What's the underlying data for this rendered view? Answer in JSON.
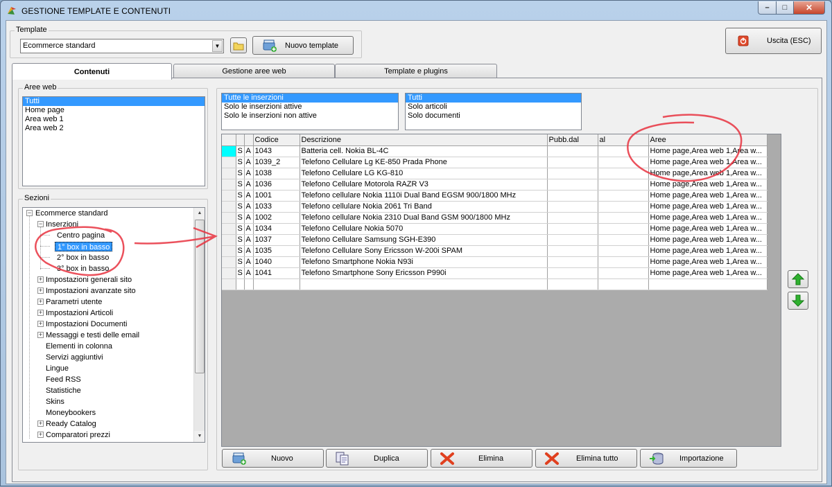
{
  "window": {
    "title": "GESTIONE TEMPLATE E CONTENUTI",
    "minimize": "–",
    "maximize": "□",
    "close": "✕"
  },
  "template": {
    "group_label": "Template",
    "selected": "Ecommerce standard",
    "new_button": "Nuovo template",
    "exit_button": "Uscita (ESC)"
  },
  "tabs": [
    {
      "label": "Contenuti",
      "active": true
    },
    {
      "label": "Gestione aree web",
      "active": false
    },
    {
      "label": "Template e plugins",
      "active": false
    }
  ],
  "aree_web": {
    "label": "Aree web",
    "items": [
      "Tutti",
      "Home page",
      "Area web 1",
      "Area web 2"
    ],
    "selected": 0
  },
  "sezioni": {
    "label": "Sezioni",
    "root": "Ecommerce standard",
    "inserzioni": "Inserzioni",
    "inserzioni_children": [
      "Centro pagina",
      "1° box in basso",
      "2° box in basso",
      "3° box in basso"
    ],
    "items": [
      "Impostazioni generali sito",
      "Impostazioni avanzate sito",
      "Parametri utente",
      "Impostazioni Articoli",
      "Impostazioni Documenti",
      "Messaggi e testi delle email",
      "Elementi in colonna",
      "Servizi aggiuntivi",
      "Lingue",
      "Feed RSS",
      "Statistiche",
      "Skins",
      "Moneybookers",
      "Ready Catalog",
      "Comparatori prezzi"
    ]
  },
  "filter_status": {
    "items": [
      "Tutte le inserzioni",
      "Solo le inserzioni attive",
      "Solo le inserzioni non attive"
    ],
    "selected": 0
  },
  "filter_type": {
    "items": [
      "Tutti",
      "Solo articoli",
      "Solo documenti"
    ],
    "selected": 0
  },
  "grid": {
    "columns": [
      "",
      "",
      "",
      "Codice",
      "Descrizione",
      "Pubb.dal",
      "al",
      "Aree"
    ],
    "rows": [
      {
        "s": "S",
        "a": "A",
        "codice": "1043",
        "descrizione": "Batteria cell. Nokia BL-4C",
        "dal": "",
        "al": "",
        "aree": "Home page,Area web 1,Area w..."
      },
      {
        "s": "S",
        "a": "A",
        "codice": "1039_2",
        "descrizione": "Telefono Cellulare Lg KE-850 Prada Phone",
        "dal": "",
        "al": "",
        "aree": "Home page,Area web 1,Area w..."
      },
      {
        "s": "S",
        "a": "A",
        "codice": "1038",
        "descrizione": "Telefono Cellulare LG KG-810",
        "dal": "",
        "al": "",
        "aree": "Home page,Area web 1,Area w..."
      },
      {
        "s": "S",
        "a": "A",
        "codice": "1036",
        "descrizione": "Telefono Cellulare Motorola RAZR V3",
        "dal": "",
        "al": "",
        "aree": "Home page,Area web 1,Area w..."
      },
      {
        "s": "S",
        "a": "A",
        "codice": "1001",
        "descrizione": "Telefono cellulare Nokia 1110i Dual Band EGSM 900/1800 MHz",
        "dal": "",
        "al": "",
        "aree": "Home page,Area web 1,Area w..."
      },
      {
        "s": "S",
        "a": "A",
        "codice": "1033",
        "descrizione": "Telefono cellulare Nokia 2061 Tri Band",
        "dal": "",
        "al": "",
        "aree": "Home page,Area web 1,Area w..."
      },
      {
        "s": "S",
        "a": "A",
        "codice": "1002",
        "descrizione": "Telefono cellulare Nokia 2310 Dual Band GSM 900/1800 MHz",
        "dal": "",
        "al": "",
        "aree": "Home page,Area web 1,Area w..."
      },
      {
        "s": "S",
        "a": "A",
        "codice": "1034",
        "descrizione": "Telefono Cellulare Nokia 5070",
        "dal": "",
        "al": "",
        "aree": "Home page,Area web 1,Area w..."
      },
      {
        "s": "S",
        "a": "A",
        "codice": "1037",
        "descrizione": "Telefono Cellulare Samsung SGH-E390",
        "dal": "",
        "al": "",
        "aree": "Home page,Area web 1,Area w..."
      },
      {
        "s": "S",
        "a": "A",
        "codice": "1035",
        "descrizione": "Telefono Cellulare Sony Ericsson W-200i SPAM",
        "dal": "",
        "al": "",
        "aree": "Home page,Area web 1,Area w..."
      },
      {
        "s": "S",
        "a": "A",
        "codice": "1040",
        "descrizione": "Telefono Smartphone Nokia N93i",
        "dal": "",
        "al": "",
        "aree": "Home page,Area web 1,Area w..."
      },
      {
        "s": "S",
        "a": "A",
        "codice": "1041",
        "descrizione": "Telefono Smartphone Sony Ericsson P990i",
        "dal": "",
        "al": "",
        "aree": "Home page,Area web 1,Area w..."
      }
    ]
  },
  "actions": {
    "nuovo": "Nuovo",
    "duplica": "Duplica",
    "elimina": "Elimina",
    "elimina_tutto": "Elimina tutto",
    "importazione": "Importazione"
  },
  "colors": {
    "selection": "#3399ff",
    "current_row_indicator": "#00ffff",
    "annotation": "#e8333f",
    "up_down_arrow": "#2fb12f",
    "delete_x": "#e0401f"
  }
}
